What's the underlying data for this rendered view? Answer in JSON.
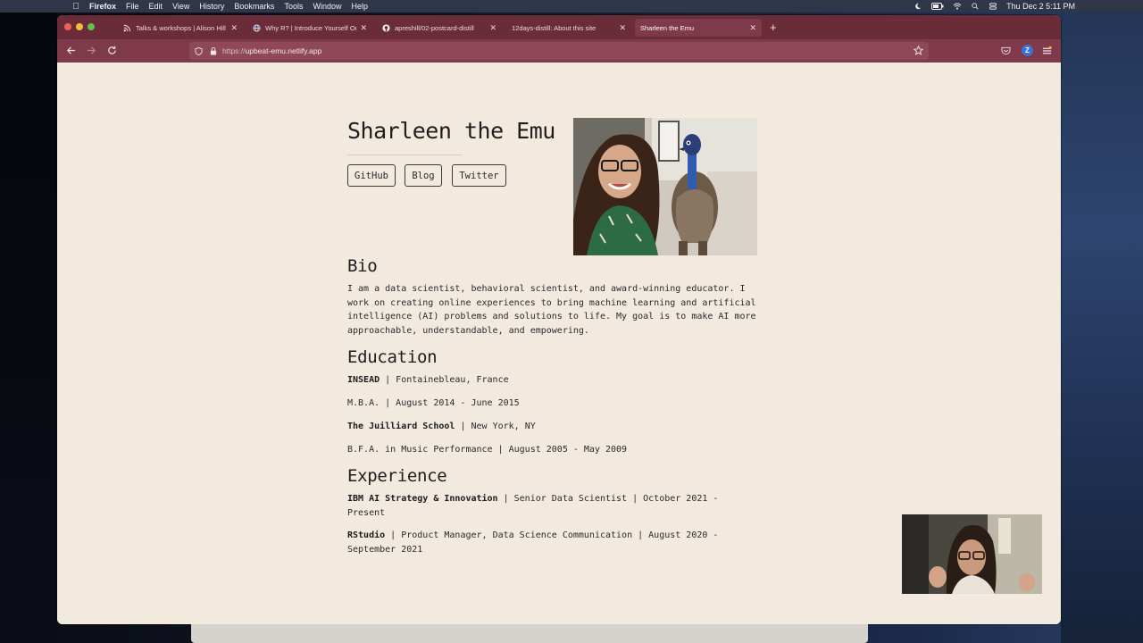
{
  "menubar": {
    "app": "Firefox",
    "items": [
      "File",
      "Edit",
      "View",
      "History",
      "Bookmarks",
      "Tools",
      "Window",
      "Help"
    ],
    "clock": "Thu Dec 2  5:11 PM"
  },
  "tabs": [
    {
      "label": "Talks & workshops | Alison Hill",
      "icon": "rss-icon"
    },
    {
      "label": "Why R? | Introduce Yourself Onl",
      "icon": "globe-icon"
    },
    {
      "label": "apreshill/02-postcard-distill",
      "icon": "github-icon"
    },
    {
      "label": "12days-distill: About this site",
      "icon": "none"
    },
    {
      "label": "Sharleen the Emu",
      "icon": "none",
      "active": true
    }
  ],
  "address": {
    "proto": "https://",
    "host": "upbeat-emu.netlify.app"
  },
  "page": {
    "title": "Sharleen the Emu",
    "links": [
      "GitHub",
      "Blog",
      "Twitter"
    ],
    "bio_heading": "Bio",
    "bio_lines": [
      "I am a data scientist, behavioral scientist, and award-winning educator. I",
      "work on creating online experiences to bring machine learning and artificial",
      "intelligence (AI) problems and solutions to life. My goal is to make AI more",
      "approachable, understandable, and empowering."
    ],
    "education_heading": "Education",
    "education": [
      {
        "bold": "INSEAD",
        "rest": " | Fontainebleau, France"
      },
      {
        "bold": "",
        "rest": "M.B.A. | August 2014 - June 2015"
      },
      {
        "bold": "The Juilliard School",
        "rest": " | New York, NY"
      },
      {
        "bold": "",
        "rest": "B.F.A. in Music Performance | August 2005 - May 2009"
      }
    ],
    "experience_heading": "Experience",
    "experience": [
      {
        "bold": "IBM AI Strategy & Innovation",
        "rest": " | Senior Data Scientist | October 2021 -",
        "cont": "Present"
      },
      {
        "bold": "RStudio",
        "rest": " | Product Manager, Data Science Communication | August 2020 -",
        "cont": "September 2021"
      }
    ]
  },
  "colors": {
    "tabbar": "#6b2c3a",
    "navbar": "#7e3a4a",
    "page_bg": "#f2e9df"
  }
}
